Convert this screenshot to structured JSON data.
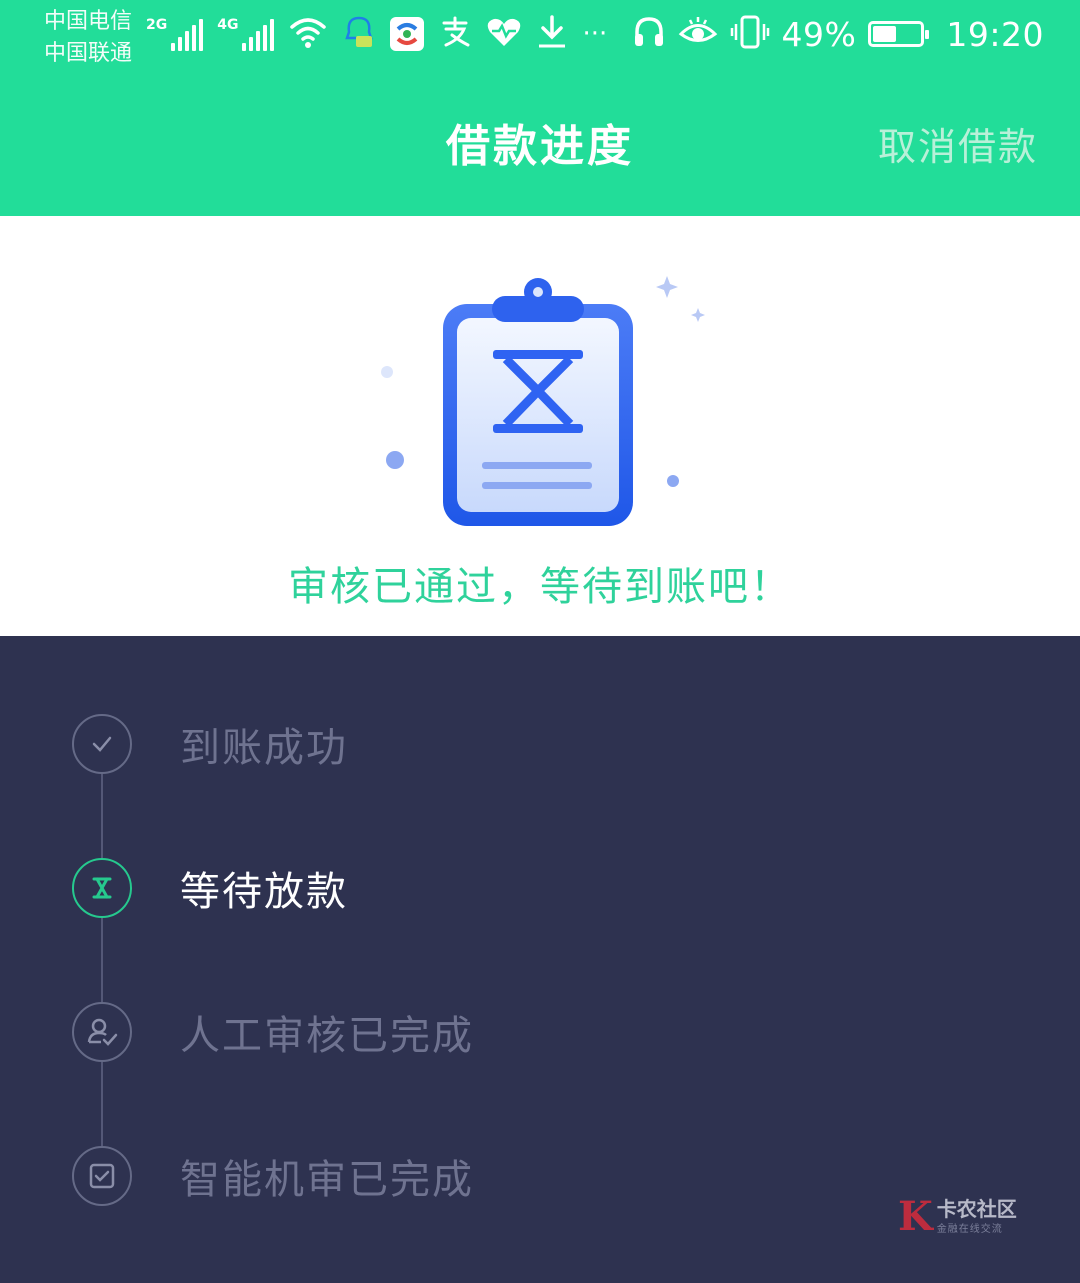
{
  "status_bar": {
    "carrier_1": "中国电信",
    "carrier_2": "中国联通",
    "network_1": "2G",
    "network_2": "4G",
    "battery_percent": "49%",
    "battery_level": 0.49,
    "time": "19:20"
  },
  "header": {
    "title": "借款进度",
    "cancel_label": "取消借款"
  },
  "hero": {
    "message": "审核已通过，等待到账吧！",
    "illustration_icon": "clipboard-hourglass-icon"
  },
  "steps": [
    {
      "label": "到账成功",
      "icon": "check-icon",
      "state": "pending"
    },
    {
      "label": "等待放款",
      "icon": "hourglass-icon",
      "state": "current"
    },
    {
      "label": "人工审核已完成",
      "icon": "user-check-icon",
      "state": "done"
    },
    {
      "label": "智能机审已完成",
      "icon": "checkbox-icon",
      "state": "done"
    }
  ],
  "watermark": {
    "name": "卡农社区",
    "subtitle": "金融在线交流"
  },
  "colors": {
    "brand_green": "#22dd99",
    "hero_text_green": "#2fd29b",
    "timeline_bg": "#2e3250",
    "illustration_blue": "#2f63f2"
  }
}
